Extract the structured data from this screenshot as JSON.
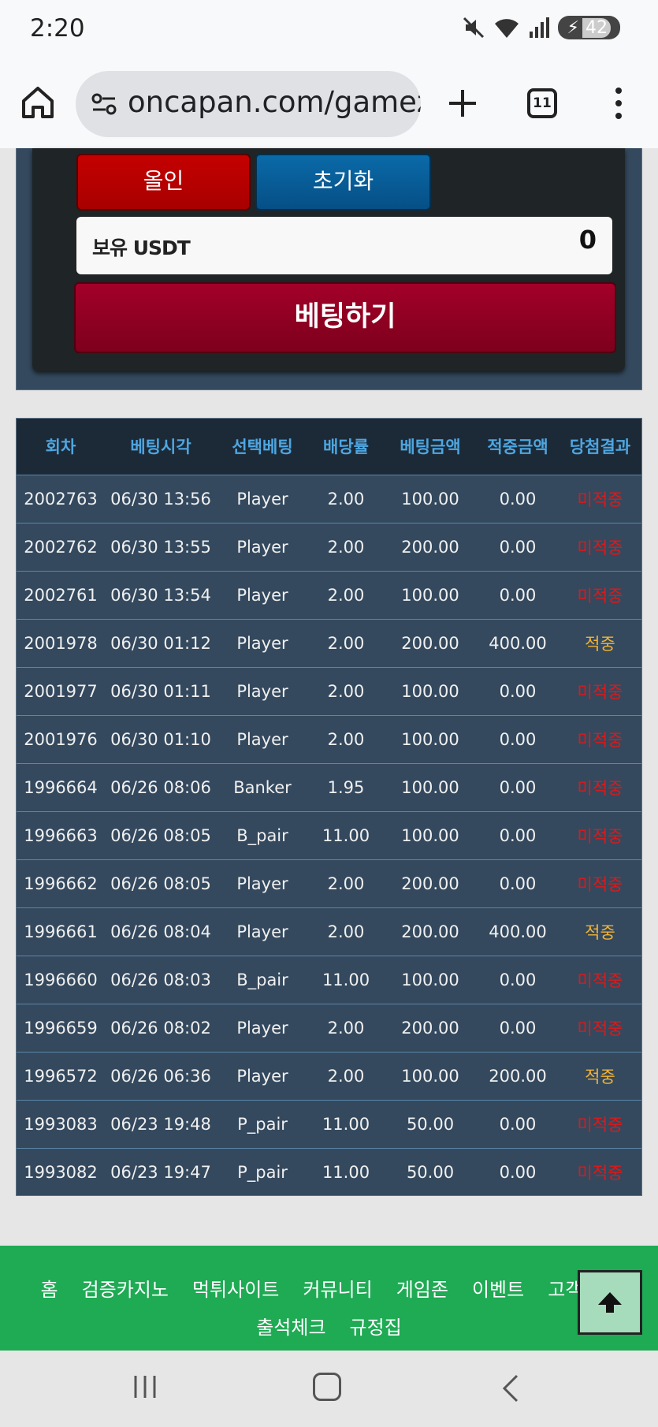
{
  "status_bar": {
    "time": "2:20",
    "battery": "42"
  },
  "browser": {
    "url": "oncapan.com/gamezo",
    "tab_count": "11"
  },
  "bet_panel": {
    "allin_label": "올인",
    "reset_label": "초기화",
    "holding_label": "보유 USDT",
    "holding_value": "0",
    "bet_button_label": "베팅하기"
  },
  "history": {
    "headers": [
      "회차",
      "베팅시각",
      "선택베팅",
      "배당률",
      "베팅금액",
      "적중금액",
      "당첨결과"
    ],
    "rows": [
      [
        "2002763",
        "06/30 13:56",
        "Player",
        "2.00",
        "100.00",
        "0.00",
        "미적중"
      ],
      [
        "2002762",
        "06/30 13:55",
        "Player",
        "2.00",
        "200.00",
        "0.00",
        "미적중"
      ],
      [
        "2002761",
        "06/30 13:54",
        "Player",
        "2.00",
        "100.00",
        "0.00",
        "미적중"
      ],
      [
        "2001978",
        "06/30 01:12",
        "Player",
        "2.00",
        "200.00",
        "400.00",
        "적중"
      ],
      [
        "2001977",
        "06/30 01:11",
        "Player",
        "2.00",
        "100.00",
        "0.00",
        "미적중"
      ],
      [
        "2001976",
        "06/30 01:10",
        "Player",
        "2.00",
        "100.00",
        "0.00",
        "미적중"
      ],
      [
        "1996664",
        "06/26 08:06",
        "Banker",
        "1.95",
        "100.00",
        "0.00",
        "미적중"
      ],
      [
        "1996663",
        "06/26 08:05",
        "B_pair",
        "11.00",
        "100.00",
        "0.00",
        "미적중"
      ],
      [
        "1996662",
        "06/26 08:05",
        "Player",
        "2.00",
        "200.00",
        "0.00",
        "미적중"
      ],
      [
        "1996661",
        "06/26 08:04",
        "Player",
        "2.00",
        "200.00",
        "400.00",
        "적중"
      ],
      [
        "1996660",
        "06/26 08:03",
        "B_pair",
        "11.00",
        "100.00",
        "0.00",
        "미적중"
      ],
      [
        "1996659",
        "06/26 08:02",
        "Player",
        "2.00",
        "200.00",
        "0.00",
        "미적중"
      ],
      [
        "1996572",
        "06/26 06:36",
        "Player",
        "2.00",
        "100.00",
        "200.00",
        "적중"
      ],
      [
        "1993083",
        "06/23 19:48",
        "P_pair",
        "11.00",
        "50.00",
        "0.00",
        "미적중"
      ],
      [
        "1993082",
        "06/23 19:47",
        "P_pair",
        "11.00",
        "50.00",
        "0.00",
        "미적중"
      ]
    ]
  },
  "footer": {
    "row1": [
      "홈",
      "검증카지노",
      "먹튀사이트",
      "커뮤니티",
      "게임존",
      "이벤트",
      "고객센터"
    ],
    "row2": [
      "출석체크",
      "규정집"
    ]
  },
  "colors": {
    "win": "#f2b233",
    "lose": "#e01818",
    "footer_bg": "#1faa54",
    "header_text": "#4ea6e0"
  },
  "icons": [
    "home-icon",
    "site-settings-icon",
    "plus-icon",
    "tabs-icon",
    "more-menu-icon",
    "arrow-up-icon",
    "nav-recent-icon",
    "nav-home-icon",
    "nav-back-icon",
    "mute-icon",
    "wifi-icon",
    "signal-icon",
    "battery-icon"
  ]
}
